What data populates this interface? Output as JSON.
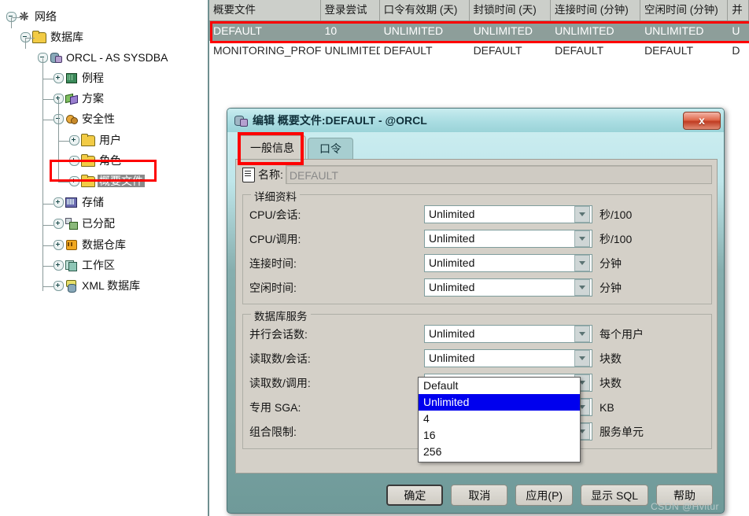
{
  "tree": {
    "nodes": [
      {
        "label": "网络",
        "icon": "network-icon",
        "expander": "minus",
        "depth": 0,
        "selected": false
      },
      {
        "label": "数据库",
        "icon": "folder-icon",
        "expander": "minus",
        "depth": 1,
        "selected": false
      },
      {
        "label": "ORCL - AS SYSDBA",
        "icon": "database-icon",
        "expander": "minus",
        "depth": 2,
        "selected": false
      },
      {
        "label": "例程",
        "icon": "instance-icon",
        "expander": "plus",
        "depth": 3,
        "selected": false
      },
      {
        "label": "方案",
        "icon": "schema-icon",
        "expander": "plus",
        "depth": 3,
        "selected": false
      },
      {
        "label": "安全性",
        "icon": "security-icon",
        "expander": "minus",
        "depth": 3,
        "selected": false
      },
      {
        "label": "用户",
        "icon": "folder-icon",
        "expander": "plus",
        "depth": 4,
        "selected": false
      },
      {
        "label": "角色",
        "icon": "folder-icon",
        "expander": "plus",
        "depth": 4,
        "selected": false
      },
      {
        "label": "概要文件",
        "icon": "folder-icon",
        "expander": "plus",
        "depth": 4,
        "selected": true
      },
      {
        "label": "存储",
        "icon": "storage-icon",
        "expander": "plus",
        "depth": 3,
        "selected": false
      },
      {
        "label": "已分配",
        "icon": "allocated-icon",
        "expander": "plus",
        "depth": 3,
        "selected": false
      },
      {
        "label": "数据仓库",
        "icon": "warehouse-icon",
        "expander": "plus",
        "depth": 3,
        "selected": false
      },
      {
        "label": "工作区",
        "icon": "workspace-icon",
        "expander": "plus",
        "depth": 3,
        "selected": false
      },
      {
        "label": "XML 数据库",
        "icon": "xmldb-icon",
        "expander": "plus",
        "depth": 3,
        "selected": false
      }
    ]
  },
  "grid": {
    "columns": [
      "概要文件",
      "登录尝试",
      "口令有效期 (天)",
      "封锁时间 (天)",
      "连接时间 (分钟)",
      "空闲时间 (分钟)",
      "并"
    ],
    "rows": [
      {
        "selected": true,
        "cells": [
          "DEFAULT",
          "10",
          "UNLIMITED",
          "UNLIMITED",
          "UNLIMITED",
          "UNLIMITED",
          "U"
        ]
      },
      {
        "selected": false,
        "cells": [
          "MONITORING_PROFILE",
          "UNLIMITED",
          "DEFAULT",
          "DEFAULT",
          "DEFAULT",
          "DEFAULT",
          "D"
        ]
      }
    ]
  },
  "dialog": {
    "title": "编辑 概要文件:DEFAULT - @ORCL",
    "close_label": "x",
    "tabs": [
      {
        "label": "一般信息",
        "active": true
      },
      {
        "label": "口令",
        "active": false
      }
    ],
    "name_label": "名称:",
    "name_value": "DEFAULT",
    "group_details": {
      "title": "详细资料",
      "rows": [
        {
          "label": "CPU/会话:",
          "value": "Unlimited",
          "unit": "秒/100"
        },
        {
          "label": "CPU/调用:",
          "value": "Unlimited",
          "unit": "秒/100"
        },
        {
          "label": "连接时间:",
          "value": "Unlimited",
          "unit": "分钟"
        },
        {
          "label": "空闲时间:",
          "value": "Unlimited",
          "unit": "分钟"
        }
      ]
    },
    "group_dbservice": {
      "title": "数据库服务",
      "rows": [
        {
          "label": "并行会话数:",
          "value": "Unlimited",
          "unit": "每个用户"
        },
        {
          "label": "读取数/会话:",
          "value": "Unlimited",
          "unit": "块数"
        },
        {
          "label": "读取数/调用:",
          "value": "Unlimited",
          "unit": "块数"
        },
        {
          "label": "专用 SGA:",
          "value": "",
          "unit": "KB"
        },
        {
          "label": "组合限制:",
          "value": "",
          "unit": "服务单元"
        }
      ]
    },
    "dropdown": {
      "open": true,
      "options": [
        "Default",
        "Unlimited",
        "4",
        "16",
        "256"
      ],
      "selected": "Unlimited"
    },
    "buttons": [
      {
        "label": "确定",
        "default": true
      },
      {
        "label": "取消",
        "default": false
      },
      {
        "label": "应用(P)",
        "default": false
      },
      {
        "label": "显示 SQL",
        "default": false
      },
      {
        "label": "帮助",
        "default": false
      }
    ]
  },
  "watermark": "CSDN @Hvitur",
  "colors": {
    "highlight_red": "#fe0000",
    "dropdown_selected": "#0000ee",
    "row_selected": "#8d9e9a",
    "dialog_face": "#d4d0c8"
  }
}
